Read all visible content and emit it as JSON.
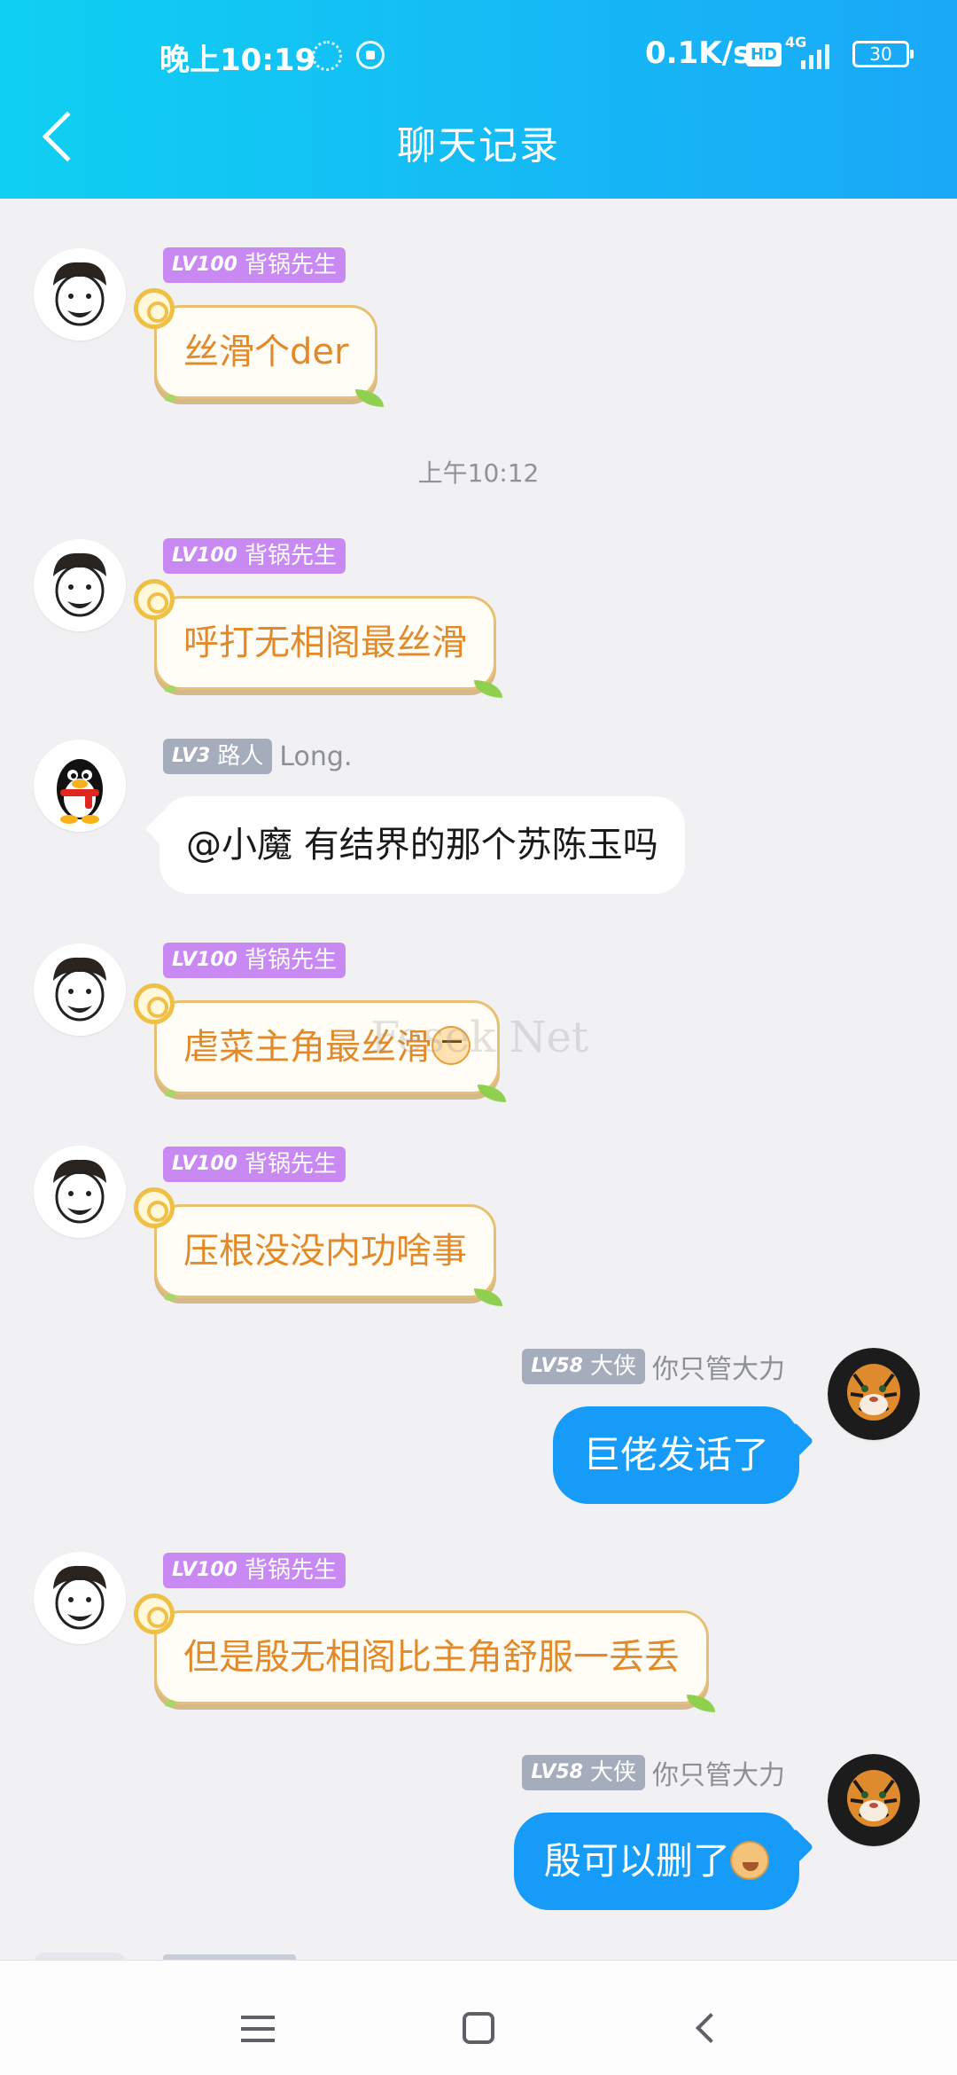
{
  "status_bar": {
    "time": "晚上10:19",
    "net_speed": "0.1K/s",
    "hd": "HD",
    "network": "4G",
    "battery": "30"
  },
  "header": {
    "title": "聊天记录"
  },
  "timestamp": "上午10:12",
  "watermark": "Fesek Net",
  "messages": [
    {
      "level": "LV100",
      "title": "背锅先生",
      "nickname": "",
      "text": "丝滑个der",
      "emoji": ""
    },
    {
      "level": "LV100",
      "title": "背锅先生",
      "nickname": "",
      "text": "呼打无相阁最丝滑",
      "emoji": ""
    },
    {
      "level": "LV3",
      "title": "路人",
      "nickname": "Long.",
      "text": "@小魔 有结界的那个苏陈玉吗",
      "emoji": ""
    },
    {
      "level": "LV100",
      "title": "背锅先生",
      "nickname": "",
      "text": "虐菜主角最丝滑",
      "emoji": "tiger-emoji"
    },
    {
      "level": "LV100",
      "title": "背锅先生",
      "nickname": "",
      "text": "压根没没内功啥事",
      "emoji": ""
    },
    {
      "level": "LV58",
      "title": "大侠",
      "nickname": "你只管大力",
      "text": "巨佬发话了",
      "emoji": ""
    },
    {
      "level": "LV100",
      "title": "背锅先生",
      "nickname": "",
      "text": "但是殷无相阁比主角舒服一丢丢",
      "emoji": ""
    },
    {
      "level": "LV58",
      "title": "大侠",
      "nickname": "你只管大力",
      "text": "殷可以删了",
      "emoji": "dog-emoji"
    }
  ],
  "colors": {
    "header_start": "#0fd0f2",
    "header_end": "#1aa8f7",
    "outgoing_bubble": "#169cf8",
    "orange_text": "#e2892a",
    "badge_purple": "#c88af2",
    "badge_gray": "#a5acbb"
  }
}
